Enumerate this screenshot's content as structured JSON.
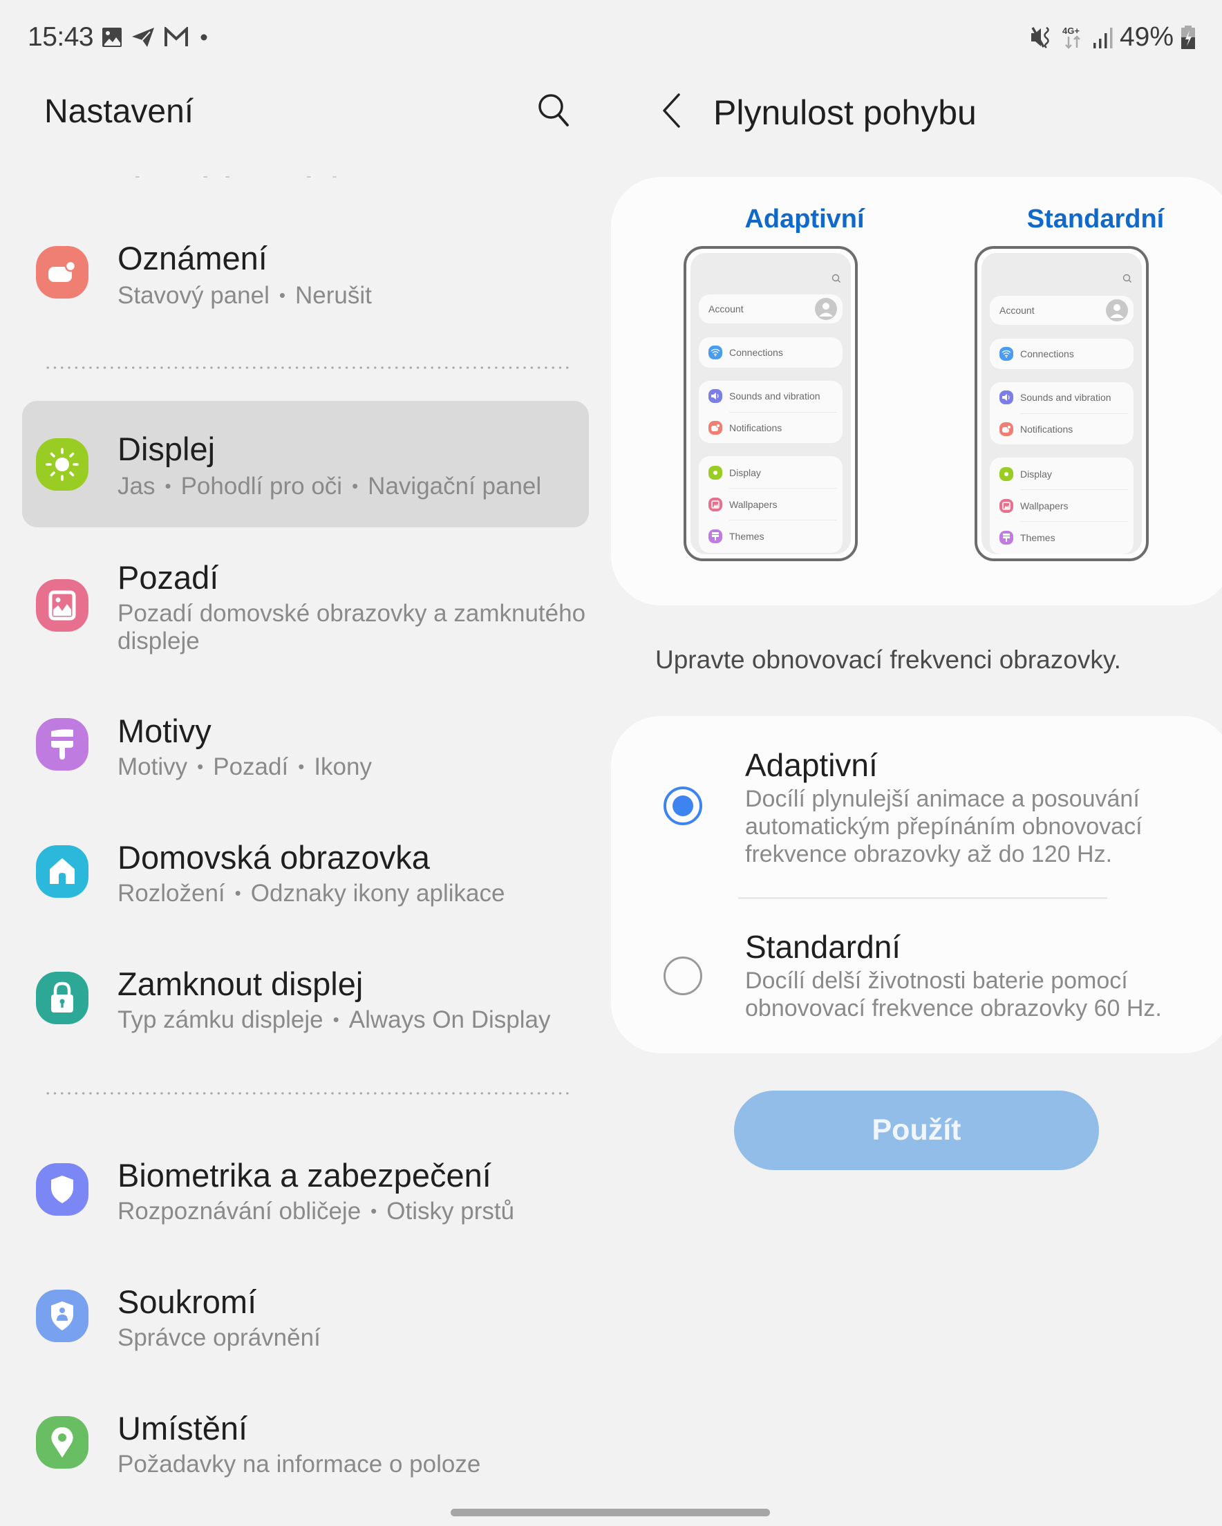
{
  "status_bar": {
    "time": "15:43",
    "left_icons": [
      "gallery-icon",
      "telegram-icon",
      "gmail-icon",
      "more-notifications-dot-icon"
    ],
    "right_icons": [
      "mute-vibrate-icon",
      "network-4g-plus-icon",
      "signal-strength-icon",
      "battery-charging-icon"
    ],
    "network_label": "4G+",
    "battery_percent": "49%"
  },
  "left_panel": {
    "title": "Nastavení",
    "search_icon": "search-icon",
    "items": [
      {
        "id": "notifications",
        "title": "Oznámení",
        "subtitle_parts": [
          "Stavový panel",
          "Nerušit"
        ],
        "icon": "notification-bubble-icon",
        "icon_color": "#ef7f73",
        "highlighted": false
      },
      {
        "id": "display",
        "title": "Displej",
        "subtitle_parts": [
          "Jas",
          "Pohodlí pro oči",
          "Navigační panel"
        ],
        "icon": "sun-icon",
        "icon_color": "#99cd24",
        "highlighted": true
      },
      {
        "id": "wallpaper",
        "title": "Pozadí",
        "subtitle_parts": [
          "Pozadí domovské obrazovky a zamknutého displeje"
        ],
        "icon": "image-icon",
        "icon_color": "#e8708f",
        "highlighted": false
      },
      {
        "id": "themes",
        "title": "Motivy",
        "subtitle_parts": [
          "Motivy",
          "Pozadí",
          "Ikony"
        ],
        "icon": "paintbrush-icon",
        "icon_color": "#c07be0",
        "highlighted": false
      },
      {
        "id": "home-screen",
        "title": "Domovská obrazovka",
        "subtitle_parts": [
          "Rozložení",
          "Odznaky ikony aplikace"
        ],
        "icon": "home-icon",
        "icon_color": "#2bb8da",
        "highlighted": false
      },
      {
        "id": "lock-screen",
        "title": "Zamknout displej",
        "subtitle_parts": [
          "Typ zámku displeje",
          "Always On Display"
        ],
        "icon": "lock-icon",
        "icon_color": "#2ea896",
        "highlighted": false
      },
      {
        "id": "biometrics",
        "title": "Biometrika a zabezpečení",
        "subtitle_parts": [
          "Rozpoznávání obličeje",
          "Otisky prstů"
        ],
        "icon": "shield-icon",
        "icon_color": "#7b87f5",
        "highlighted": false
      },
      {
        "id": "privacy",
        "title": "Soukromí",
        "subtitle_parts": [
          "Správce oprávnění"
        ],
        "icon": "privacy-shield-icon",
        "icon_color": "#78a2ef",
        "highlighted": false
      },
      {
        "id": "location",
        "title": "Umístění",
        "subtitle_parts": [
          "Požadavky na informace o poloze"
        ],
        "icon": "location-pin-icon",
        "icon_color": "#69bd62",
        "highlighted": false
      }
    ]
  },
  "right_panel": {
    "back_icon": "chevron-left-icon",
    "title": "Plynulost pohybu",
    "preview": {
      "adaptive_label": "Adaptivní",
      "standard_label": "Standardní",
      "label_color": "#1069c9",
      "phone_items": {
        "account": "Account",
        "connections": "Connections",
        "sounds": "Sounds and vibration",
        "notifications": "Notifications",
        "display": "Display",
        "wallpapers": "Wallpapers",
        "themes": "Themes"
      }
    },
    "description": "Upravte obnovovací frekvenci obrazovky.",
    "options": [
      {
        "id": "adaptive",
        "title": "Adaptivní",
        "description": "Docílí plynulejší animace a posouvání automatickým přepínáním obnovovací frekvence obrazovky až do 120 Hz.",
        "selected": true
      },
      {
        "id": "standard",
        "title": "Standardní",
        "description": "Docílí delší životnosti baterie pomocí obnovovací frekvence obrazovky 60 Hz.",
        "selected": false
      }
    ],
    "apply_label": "Použít",
    "apply_enabled": false,
    "accent_color": "#3d84f0"
  }
}
